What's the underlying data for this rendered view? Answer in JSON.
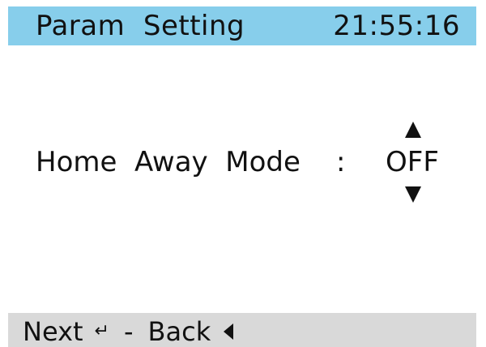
{
  "header": {
    "title": "Param  Setting",
    "clock": "21:55:16",
    "background_color": "#87ceeb"
  },
  "parameter": {
    "label": "Home  Away  Mode",
    "colon": ":",
    "value": "OFF",
    "up_icon": "triangle-up-icon",
    "down_icon": "triangle-down-icon"
  },
  "footer": {
    "next_label": "Next",
    "enter_icon": "↵",
    "separator": "-",
    "back_label": "Back",
    "back_icon": "triangle-left-icon",
    "background_color": "#d9d9d9"
  }
}
